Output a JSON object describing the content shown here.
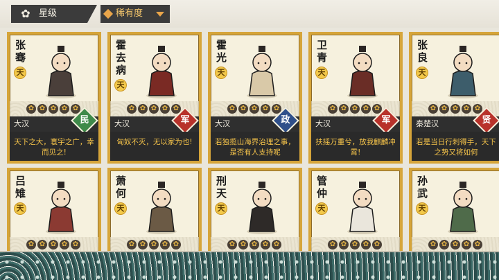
{
  "filters": {
    "star_tab_label": "星级",
    "rarity_tab_label": "稀有度",
    "star_icon": "flower-icon",
    "rarity_icon": "diamond-icon",
    "dropdown_icon": "triangle-down-icon"
  },
  "colors": {
    "card_border": "#d6a53a",
    "card_bg": "#f6f1de",
    "quote_text": "#f6c44a",
    "class_min": "#3f8a4a",
    "class_army": "#b8322b",
    "class_politics": "#2f4f8a",
    "class_sage": "#b8322b"
  },
  "cards": [
    {
      "name": "张骞",
      "rank": "天",
      "stars": 5,
      "faction": "大汉",
      "class": "民",
      "class_color": "#3f8a4a",
      "quote": "天下之大，寰宇之广，幸而见之!"
    },
    {
      "name": "霍去病",
      "rank": "天",
      "stars": 5,
      "faction": "大汉",
      "class": "军",
      "class_color": "#b8322b",
      "quote": "匈奴不灭，无以家为也!"
    },
    {
      "name": "霍光",
      "rank": "天",
      "stars": 5,
      "faction": "大汉",
      "class": "政",
      "class_color": "#2f4f8a",
      "quote": "若独揽山海界治理之事，是否有人支持呢"
    },
    {
      "name": "卫青",
      "rank": "天",
      "stars": 5,
      "faction": "大汉",
      "class": "军",
      "class_color": "#b8322b",
      "quote": "扶摇万重兮，放我麒麟冲霄!"
    },
    {
      "name": "张良",
      "rank": "天",
      "stars": 5,
      "faction": "秦楚汉",
      "class": "贤",
      "class_color": "#b8322b",
      "quote": "若是当日行刺得手，天下之势又将如何"
    },
    {
      "name": "吕雉",
      "rank": "天",
      "stars": 5
    },
    {
      "name": "萧何",
      "rank": "天",
      "stars": 5
    },
    {
      "name": "刑天",
      "rank": "天",
      "stars": 5
    },
    {
      "name": "管仲",
      "rank": "天",
      "stars": 5
    },
    {
      "name": "孙武",
      "rank": "天",
      "stars": 5
    }
  ]
}
